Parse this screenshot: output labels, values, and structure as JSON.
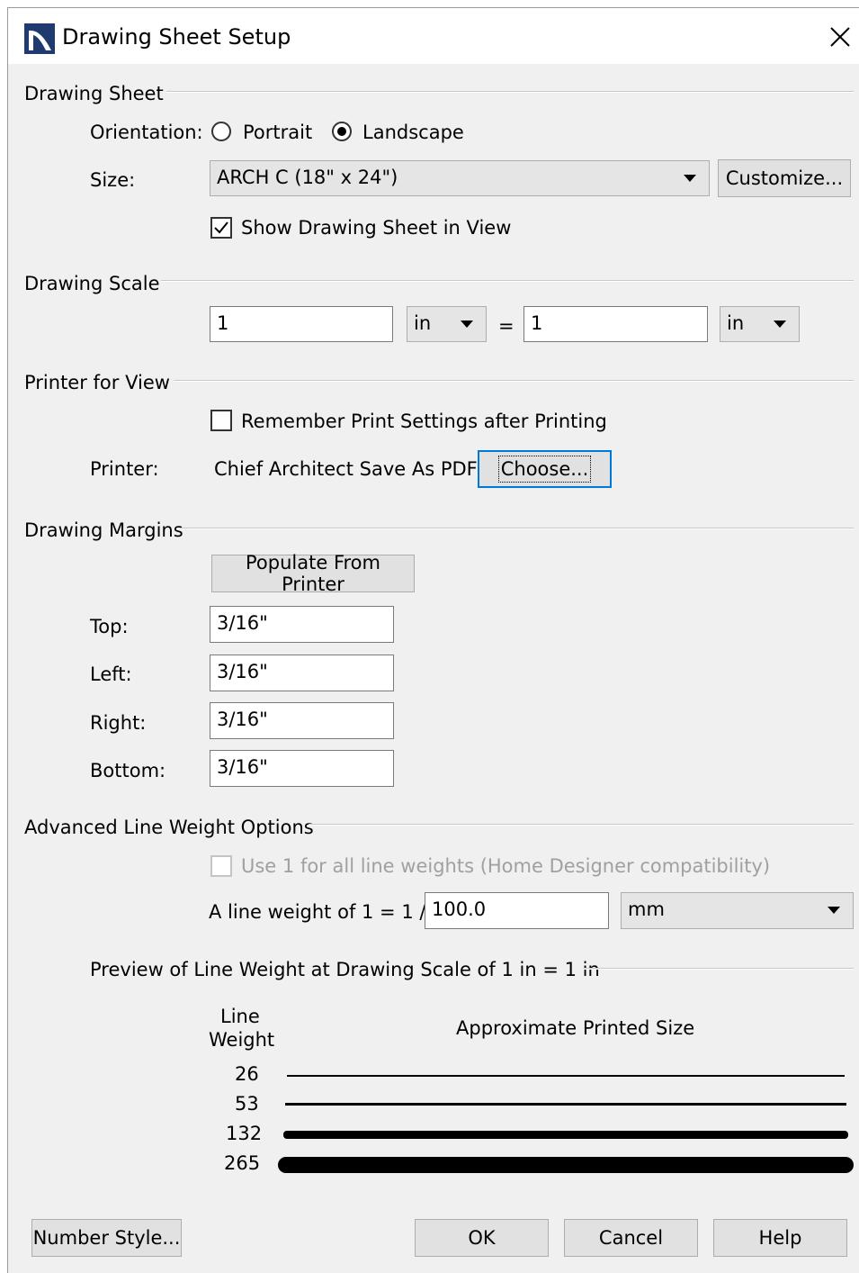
{
  "window": {
    "title": "Drawing Sheet Setup"
  },
  "drawing_sheet": {
    "group_label": "Drawing Sheet",
    "orientation_label": "Orientation:",
    "portrait_label": "Portrait",
    "landscape_label": "Landscape",
    "orientation_selected": "Landscape",
    "size_label": "Size:",
    "size_value": "ARCH C  (18\" x 24\")",
    "customize_label": "Customize...",
    "show_sheet_label": "Show Drawing Sheet in View",
    "show_sheet_checked": true
  },
  "drawing_scale": {
    "group_label": "Drawing Scale",
    "left_value": "1",
    "left_unit": "in",
    "equals": "=",
    "right_value": "1",
    "right_unit": "in"
  },
  "printer_for_view": {
    "group_label": "Printer for View",
    "remember_label": "Remember Print Settings after Printing",
    "remember_checked": false,
    "printer_label": "Printer:",
    "printer_name": "Chief Architect Save As PDF",
    "choose_label": "Choose..."
  },
  "drawing_margins": {
    "group_label": "Drawing Margins",
    "populate_label": "Populate From Printer",
    "top_label": "Top:",
    "top_value": "3/16\"",
    "left_label": "Left:",
    "left_value": "3/16\"",
    "right_label": "Right:",
    "right_value": "3/16\"",
    "bottom_label": "Bottom:",
    "bottom_value": "3/16\""
  },
  "advanced_line_weight": {
    "group_label": "Advanced Line Weight Options",
    "use_one_label": "Use 1 for all line weights (Home Designer compatibility)",
    "use_one_checked": false,
    "use_one_enabled": false,
    "line_weight_label": "A line weight of 1 = 1 /",
    "line_weight_value": "100.0",
    "line_weight_unit": "mm"
  },
  "preview": {
    "group_label": "Preview of Line Weight at Drawing Scale of  1 in = 1 in",
    "col_line_weight_1": "Line",
    "col_line_weight_2": "Weight",
    "col_size": "Approximate Printed Size",
    "rows": [
      {
        "weight": "26"
      },
      {
        "weight": "53"
      },
      {
        "weight": "132"
      },
      {
        "weight": "265"
      }
    ]
  },
  "footer": {
    "number_style_label": "Number Style...",
    "ok_label": "OK",
    "cancel_label": "Cancel",
    "help_label": "Help"
  },
  "colors": {
    "focus": "#0078d7",
    "dialog_bg": "#f0f0f0"
  },
  "icons": [
    "app-logo-icon",
    "close-icon",
    "dropdown-arrow-icon",
    "checkmark-icon"
  ]
}
